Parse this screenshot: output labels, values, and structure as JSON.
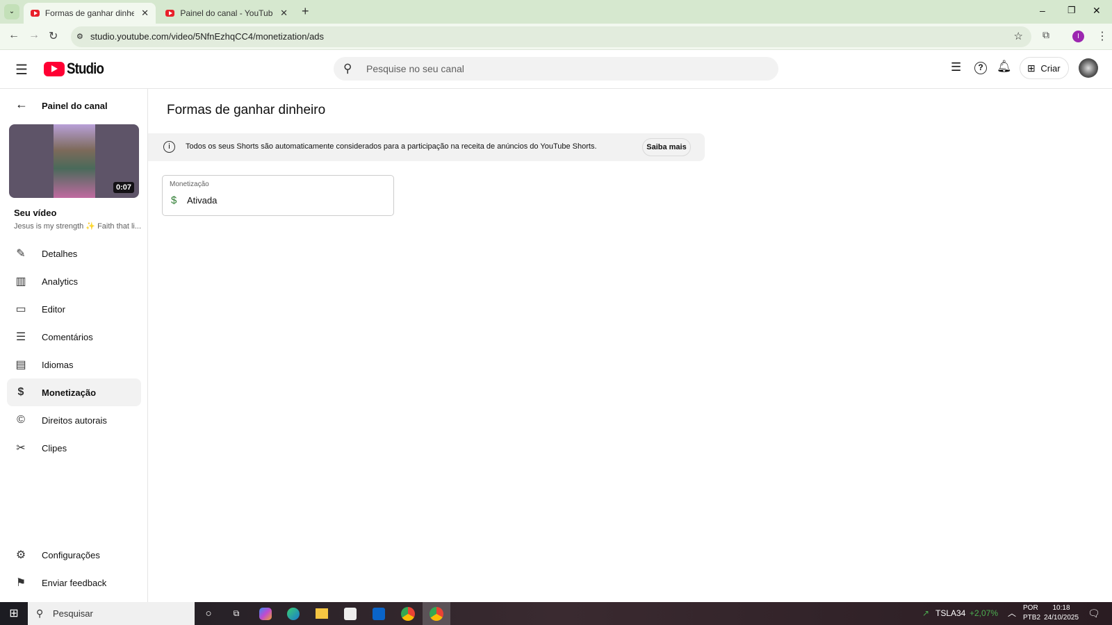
{
  "browser": {
    "tabs": [
      {
        "title": "Formas de ganhar dinheiro - YouTube Studio"
      },
      {
        "title": "Painel do canal - YouTube Studio"
      }
    ],
    "url": "studio.youtube.com/video/5NfnEzhqCC4/monetization/ads",
    "profile_initial": "I"
  },
  "header": {
    "logo": "Studio",
    "search_placeholder": "Pesquise no seu canal",
    "create_label": "Criar"
  },
  "sidebar": {
    "back_label": "Painel do canal",
    "video": {
      "duration": "0:07",
      "heading": "Seu vídeo",
      "title": "Jesus is my strength ✨ Faith that li..."
    },
    "items": [
      {
        "label": "Detalhes",
        "icon": "pencil-icon"
      },
      {
        "label": "Analytics",
        "icon": "analytics-icon"
      },
      {
        "label": "Editor",
        "icon": "editor-icon"
      },
      {
        "label": "Comentários",
        "icon": "comments-icon"
      },
      {
        "label": "Idiomas",
        "icon": "subtitles-icon"
      },
      {
        "label": "Monetização",
        "icon": "dollar-icon"
      },
      {
        "label": "Direitos autorais",
        "icon": "copyright-icon"
      },
      {
        "label": "Clipes",
        "icon": "scissors-icon"
      }
    ],
    "bottom": [
      {
        "label": "Configurações"
      },
      {
        "label": "Enviar feedback"
      }
    ]
  },
  "main": {
    "title": "Formas de ganhar dinheiro",
    "banner": {
      "text": "Todos os seus Shorts são automaticamente considerados para a participação na receita de anúncios do YouTube Shorts.",
      "button": "Saiba mais"
    },
    "card": {
      "label": "Monetização",
      "status": "Ativada",
      "status_color": "#2e7d32"
    }
  },
  "taskbar": {
    "search": "Pesquisar",
    "stock": "TSLA34",
    "change": "+2,07%",
    "lang1": "POR",
    "lang2": "PTB2",
    "time": "10:18",
    "date": "24/10/2025"
  }
}
